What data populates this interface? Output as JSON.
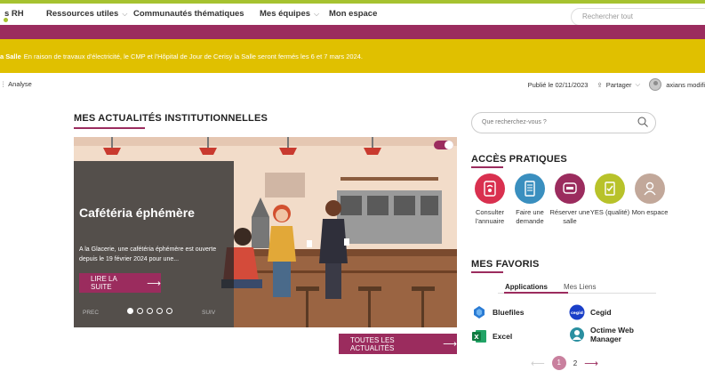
{
  "nav": {
    "items": [
      {
        "label": "s RH",
        "has_chevron": false
      },
      {
        "label": "Ressources utiles",
        "has_chevron": true
      },
      {
        "label": "Communautés thématiques",
        "has_chevron": false
      },
      {
        "label": "Mes équipes",
        "has_chevron": true
      },
      {
        "label": "Mon espace",
        "has_chevron": false
      }
    ],
    "search_placeholder": "Rechercher tout"
  },
  "alert": {
    "bold": "a Salle",
    "text": "En raison de travaux d'électricité, le CMP et l'Hôpital de Jour de Cerisy la Salle seront fermés les 6 et 7 mars 2024."
  },
  "page": {
    "breadcrumb": "Analyse",
    "published": "Publié le 02/11/2023",
    "share": "Partager",
    "author": "axians modifi"
  },
  "news": {
    "section_title": "MES ACTUALITÉS INSTITUTIONNELLES",
    "slide_title": "Cafétéria éphémère",
    "slide_text": "A la Glacerie, une cafétéria éphémère est ouverte depuis le 19 février 2024 pour une...",
    "read_more": "LIRE LA SUITE",
    "prev": "PREC",
    "next": "SUIV",
    "all_news": "TOUTES LES ACTUALITÉS"
  },
  "right": {
    "search_placeholder": "Que recherchez-vous ?",
    "access_title": "ACCÈS PRATIQUES",
    "apps": [
      {
        "label": "Consulter l'annuaire",
        "icon": "phone-book-icon",
        "color": "#d9304f"
      },
      {
        "label": "Faire une demande",
        "icon": "form-icon",
        "color": "#3a8fbf"
      },
      {
        "label": "Réserver une salle",
        "icon": "meeting-room-icon",
        "color": "#9b2c5e"
      },
      {
        "label": "YES (qualité)",
        "icon": "checklist-icon",
        "color": "#b8c22a"
      },
      {
        "label": "Mon espace",
        "icon": "user-icon",
        "color": "#c2a89a"
      }
    ],
    "favorites_title": "MES FAVORIS",
    "tabs": [
      "Applications",
      "Mes Liens"
    ],
    "favorites": [
      {
        "label": "Bluefiles",
        "icon": "bluefiles-icon"
      },
      {
        "label": "Cegid",
        "icon": "cegid-icon"
      },
      {
        "label": "Excel",
        "icon": "excel-icon"
      },
      {
        "label": "Octime Web Manager",
        "icon": "octime-icon"
      }
    ],
    "pager": {
      "current": "1",
      "next_page": "2"
    }
  }
}
